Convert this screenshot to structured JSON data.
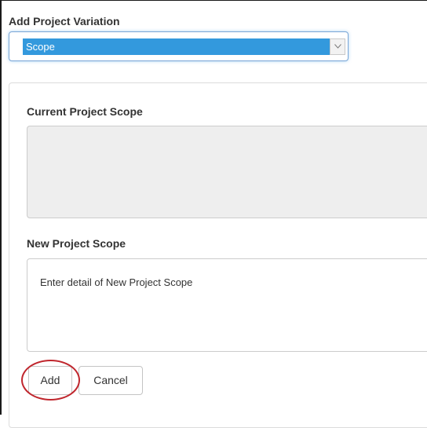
{
  "form": {
    "title": "Add Project Variation",
    "variation_select": {
      "selected": "Scope",
      "arrow_icon": "chevron-down-icon"
    }
  },
  "current_scope": {
    "label": "Current Project Scope",
    "value": ""
  },
  "new_scope": {
    "label": "New Project Scope",
    "placeholder": "Enter detail of New Project Scope"
  },
  "actions": {
    "add_label": "Add",
    "cancel_label": "Cancel"
  },
  "colors": {
    "select_highlight": "#3399dd",
    "annotation_ring": "#c0262d",
    "readonly_fill": "#eeeeee"
  }
}
